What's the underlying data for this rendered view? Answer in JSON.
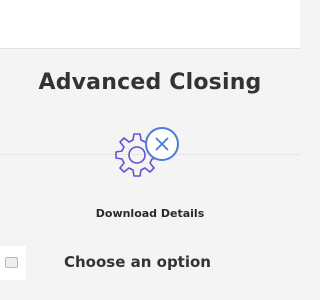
{
  "header": {
    "title": "Advanced Closing"
  },
  "hero": {
    "icon": "gear-with-x-icon",
    "gear_color": "#6a4fd6",
    "badge_color": "#4b7bd8"
  },
  "actions": {
    "download_label": "Download Details"
  },
  "options": {
    "heading": "Choose an option"
  }
}
